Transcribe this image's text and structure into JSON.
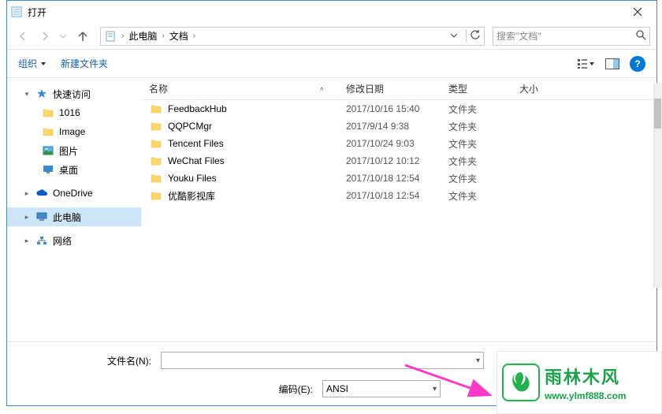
{
  "window": {
    "title": "打开"
  },
  "nav": {
    "breadcrumb": {
      "pc": "此电脑",
      "docs": "文档"
    },
    "search_placeholder": "搜索\"文档\""
  },
  "toolbar": {
    "organize": "组织",
    "new_folder": "新建文件夹"
  },
  "sidebar": {
    "quick_access": "快速访问",
    "items_quick": [
      "1016",
      "Image",
      "图片",
      "桌面"
    ],
    "onedrive": "OneDrive",
    "this_pc": "此电脑",
    "network": "网络"
  },
  "columns": {
    "name": "名称",
    "date": "修改日期",
    "type": "类型",
    "size": "大小"
  },
  "files": [
    {
      "name": "FeedbackHub",
      "date": "2017/10/16 15:40",
      "type": "文件夹"
    },
    {
      "name": "QQPCMgr",
      "date": "2017/9/14 9:38",
      "type": "文件夹"
    },
    {
      "name": "Tencent Files",
      "date": "2017/10/24 9:03",
      "type": "文件夹"
    },
    {
      "name": "WeChat Files",
      "date": "2017/10/12 10:12",
      "type": "文件夹"
    },
    {
      "name": "Youku Files",
      "date": "2017/10/18 12:54",
      "type": "文件夹"
    },
    {
      "name": "优酷影视库",
      "date": "2017/10/18 12:54",
      "type": "文件夹"
    }
  ],
  "bottom": {
    "filename_label": "文件名(N):",
    "encoding_label": "编码(E):",
    "encoding_value": "ANSI"
  },
  "overlay": {
    "brand_cn": "雨林木风",
    "brand_url": "www.ylmf888.com"
  },
  "help_glyph": "?"
}
